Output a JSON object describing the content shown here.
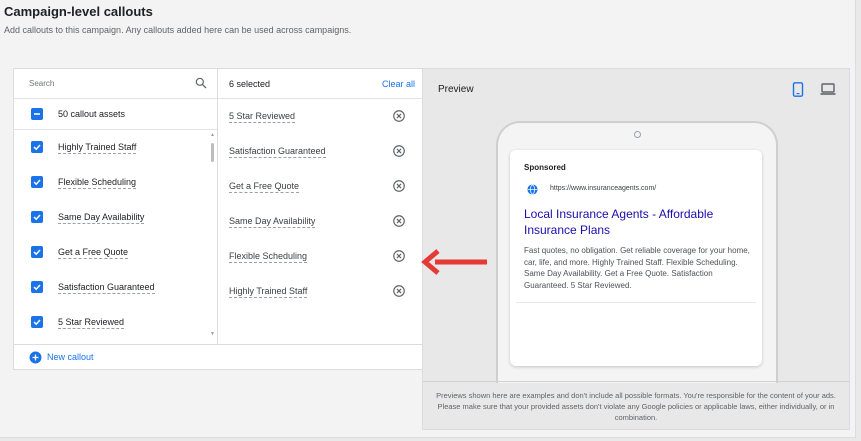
{
  "header": {
    "title": "Campaign-level callouts",
    "subtitle": "Add callouts to this campaign. Any callouts added here can be used across campaigns."
  },
  "search": {
    "placeholder": "Search"
  },
  "asset_list": {
    "select_all_label": "50 callout assets",
    "items": [
      {
        "label": "Highly Trained Staff",
        "checked": true
      },
      {
        "label": "Flexible Scheduling",
        "checked": true
      },
      {
        "label": "Same Day Availability",
        "checked": true
      },
      {
        "label": "Get a Free Quote",
        "checked": true
      },
      {
        "label": "Satisfaction Guaranteed",
        "checked": true
      },
      {
        "label": "5 Star Reviewed",
        "checked": true
      }
    ]
  },
  "selected": {
    "count_label": "6 selected",
    "clear_label": "Clear all",
    "items": [
      {
        "label": "5 Star Reviewed"
      },
      {
        "label": "Satisfaction Guaranteed"
      },
      {
        "label": "Get a Free Quote"
      },
      {
        "label": "Same Day Availability"
      },
      {
        "label": "Flexible Scheduling"
      },
      {
        "label": "Highly Trained Staff"
      }
    ]
  },
  "new_callout_label": "New callout",
  "preview": {
    "title": "Preview",
    "ad": {
      "sponsored": "Sponsored",
      "url": "https://www.insuranceagents.com/",
      "headline": "Local Insurance Agents - Affordable Insurance Plans",
      "description": "Fast quotes, no obligation. Get reliable coverage for your home, car, life, and more. Highly Trained Staff. Flexible Scheduling. Same Day Availability. Get a Free Quote. Satisfaction Guaranteed. 5 Star Reviewed."
    },
    "note": "Previews shown here are examples and don't include all possible formats. You're responsible for the content of your ads. Please make sure that your provided assets don't violate any Google policies or applicable laws, either individually, or in combination."
  },
  "icons": {
    "search": "search-icon",
    "checkbox": "checkbox-checked-icon",
    "indeterminate": "checkbox-indeterminate-icon",
    "remove": "remove-circle-x-icon",
    "add": "plus-circle-icon",
    "mobile": "mobile-phone-icon",
    "desktop": "laptop-icon",
    "globe": "globe-icon",
    "arrow": "red-arrow-left-icon"
  },
  "colors": {
    "accent": "#1a73e8",
    "ad_headline": "#1a0dab",
    "arrow": "#e53935"
  }
}
